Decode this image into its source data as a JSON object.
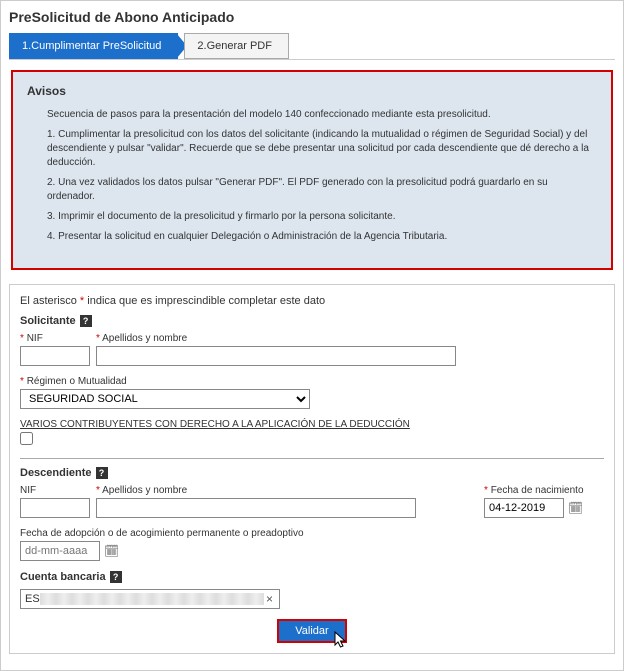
{
  "page_title": "PreSolicitud de Abono Anticipado",
  "steps": {
    "s1": "1.Cumplimentar PreSolicitud",
    "s2": "2.Generar PDF"
  },
  "notice": {
    "title": "Avisos",
    "intro": "Secuencia de pasos para la presentación del modelo 140 confeccionado mediante esta presolicitud.",
    "l1": "1. Cumplimentar la presolicitud con los datos del solicitante (indicando la mutualidad o régimen de Seguridad Social) y del descendiente y pulsar \"validar\". Recuerde que se debe presentar una solicitud por cada descendiente que dé derecho a la deducción.",
    "l2": "2. Una vez validados los datos pulsar \"Generar PDF\". El PDF generado con la presolicitud podrá guardarlo en su ordenador.",
    "l3": "3. Imprimir el documento de la presolicitud y firmarlo por la persona solicitante.",
    "l4": "4. Presentar la solicitud en cualquier Delegación o Administración de la Agencia Tributaria."
  },
  "asterisk_note_pre": "El asterisco ",
  "asterisk_star": "*",
  "asterisk_note_post": " indica que es imprescindible completar este dato",
  "solicitante": {
    "title": "Solicitante",
    "nif_label": "NIF",
    "nif_value": "",
    "apellidos_label": "Apellidos y nombre",
    "apellidos_value": "",
    "regimen_label": "Régimen o Mutualidad",
    "regimen_value": "SEGURIDAD SOCIAL",
    "varios_label": "VARIOS CONTRIBUYENTES CON DERECHO A LA APLICACIÓN DE LA DEDUCCIÓN"
  },
  "descendiente": {
    "title": "Descendiente",
    "nif_label": "NIF",
    "nif_value": "",
    "apellidos_label": "Apellidos y nombre",
    "apellidos_value": "",
    "fecha_nac_label": "Fecha de nacimiento",
    "fecha_nac_value": "04-12-2019",
    "fecha_adop_label": "Fecha de adopción o de acogimiento permanente o preadoptivo",
    "fecha_adop_placeholder": "dd-mm-aaaa"
  },
  "cuenta": {
    "title": "Cuenta bancaria",
    "iban_prefix": "ES",
    "iban_value": ""
  },
  "validar_label": "Validar",
  "icons": {
    "help": "?",
    "calendar": "🗓",
    "cursor": "↖",
    "clear": "×"
  }
}
